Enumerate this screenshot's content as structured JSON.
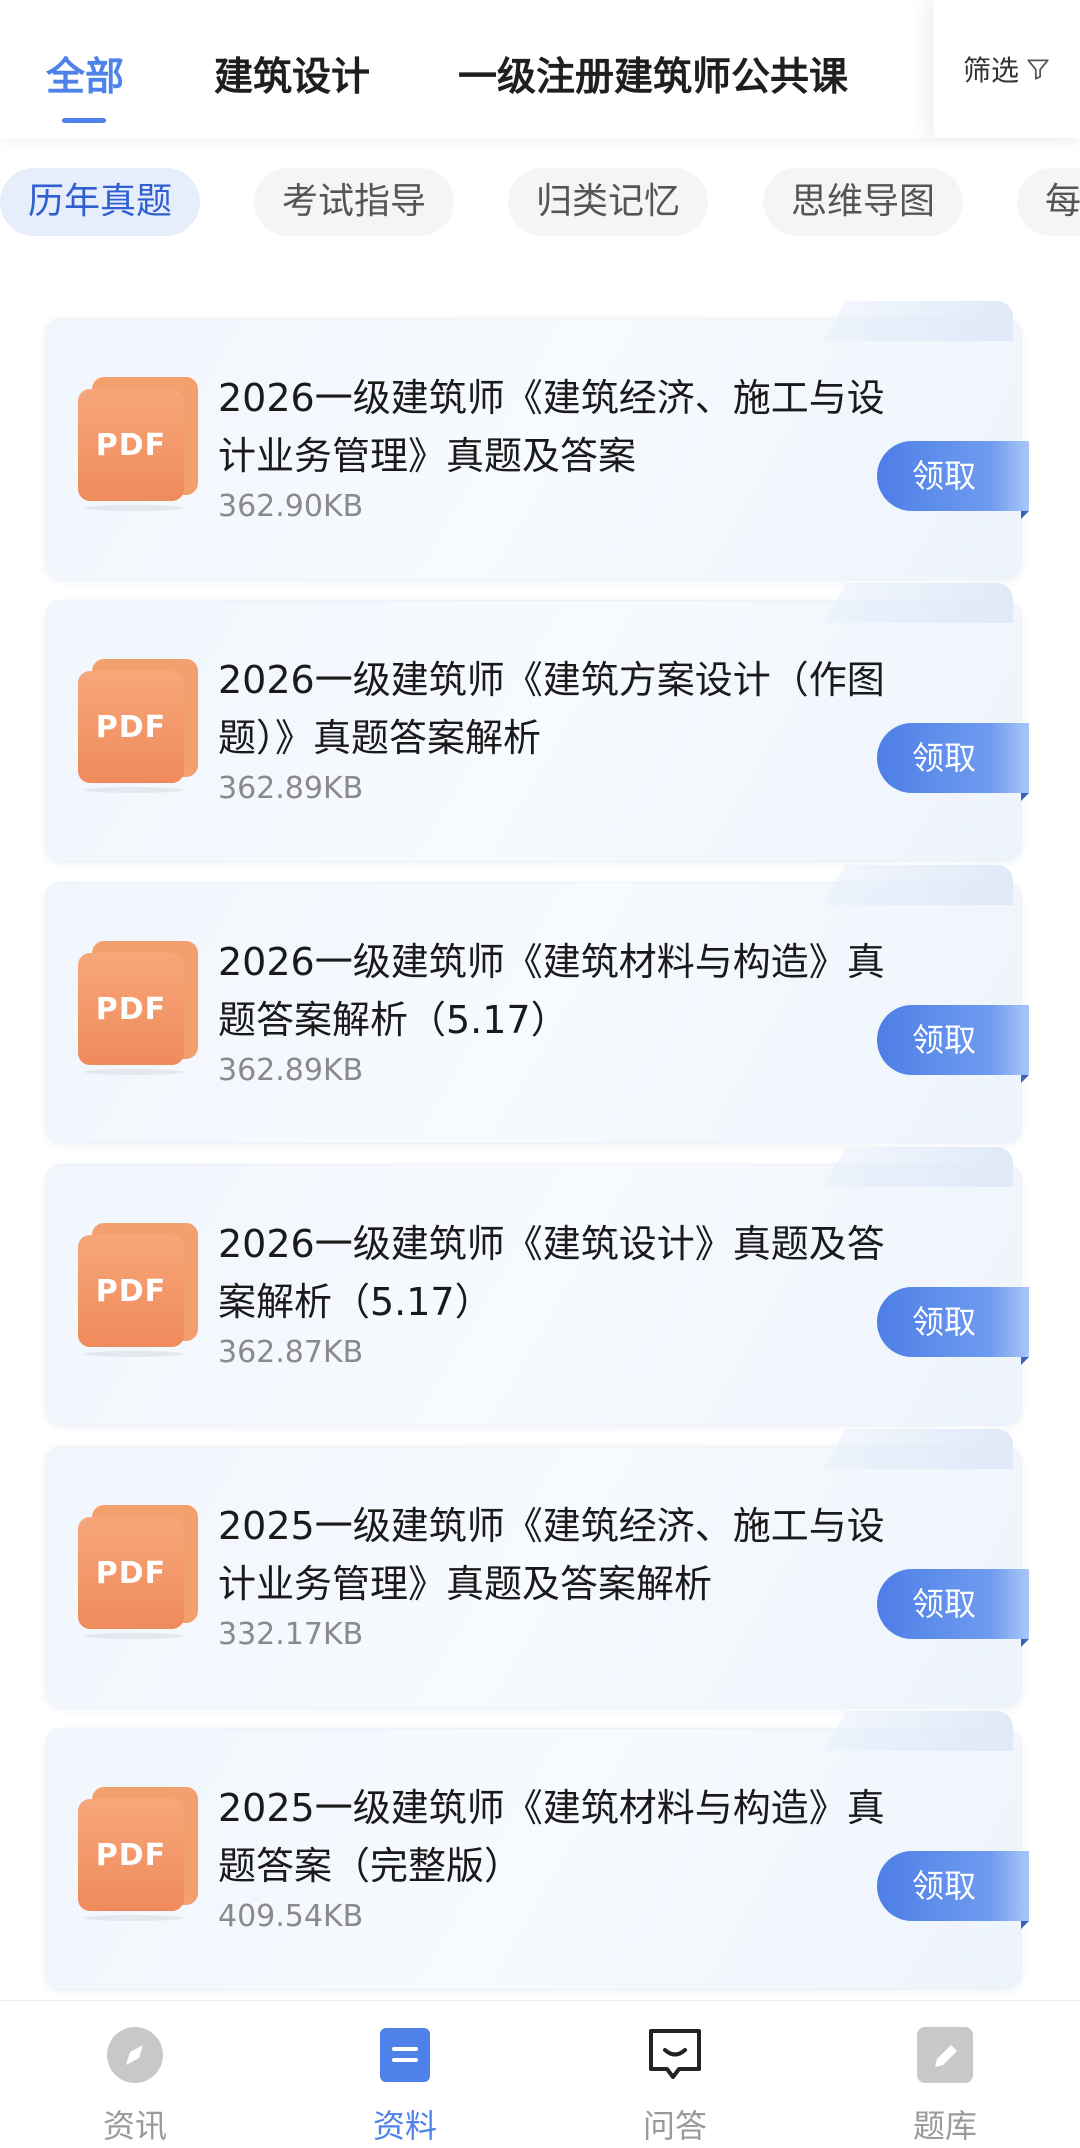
{
  "tabs": [
    {
      "label": "全部",
      "active": true
    },
    {
      "label": "建筑设计",
      "active": false
    },
    {
      "label": "一级注册建筑师公共课",
      "active": false
    }
  ],
  "filter": {
    "label": "筛选",
    "icon": "filter-icon"
  },
  "chips": [
    {
      "label": "历年真题",
      "active": true
    },
    {
      "label": "考试指导",
      "active": false
    },
    {
      "label": "归类记忆",
      "active": false
    },
    {
      "label": "思维导图",
      "active": false
    },
    {
      "label": "每",
      "active": false
    }
  ],
  "items": [
    {
      "icon_text": "PDF",
      "title": "2026一级建筑师《建筑经济、施工与设计业务管理》真题及答案",
      "size": "362.90KB",
      "button": "领取"
    },
    {
      "icon_text": "PDF",
      "title": "2026一级建筑师《建筑方案设计（作图题）》真题答案解析",
      "size": "362.89KB",
      "button": "领取"
    },
    {
      "icon_text": "PDF",
      "title": "2026一级建筑师《建筑材料与构造》真题答案解析（5.17）",
      "size": "362.89KB",
      "button": "领取"
    },
    {
      "icon_text": "PDF",
      "title": "2026一级建筑师《建筑设计》真题及答案解析（5.17）",
      "size": "362.87KB",
      "button": "领取"
    },
    {
      "icon_text": "PDF",
      "title": "2025一级建筑师《建筑经济、施工与设计业务管理》真题及答案解析",
      "size": "332.17KB",
      "button": "领取"
    },
    {
      "icon_text": "PDF",
      "title": "2025一级建筑师《建筑材料与构造》真题答案（完整版）",
      "size": "409.54KB",
      "button": "领取"
    }
  ],
  "bottom_nav": [
    {
      "label": "资讯",
      "icon": "compass-icon",
      "active": false
    },
    {
      "label": "资料",
      "icon": "document-icon",
      "active": true
    },
    {
      "label": "问答",
      "icon": "chat-bubble-icon",
      "active": false
    },
    {
      "label": "题库",
      "icon": "pencil-icon",
      "active": false
    }
  ],
  "colors": {
    "accent": "#4f82e9",
    "pdf_orange": "#ef8a5b",
    "chip_active_bg": "#e6eefc",
    "muted_text": "#8a8a8a"
  }
}
